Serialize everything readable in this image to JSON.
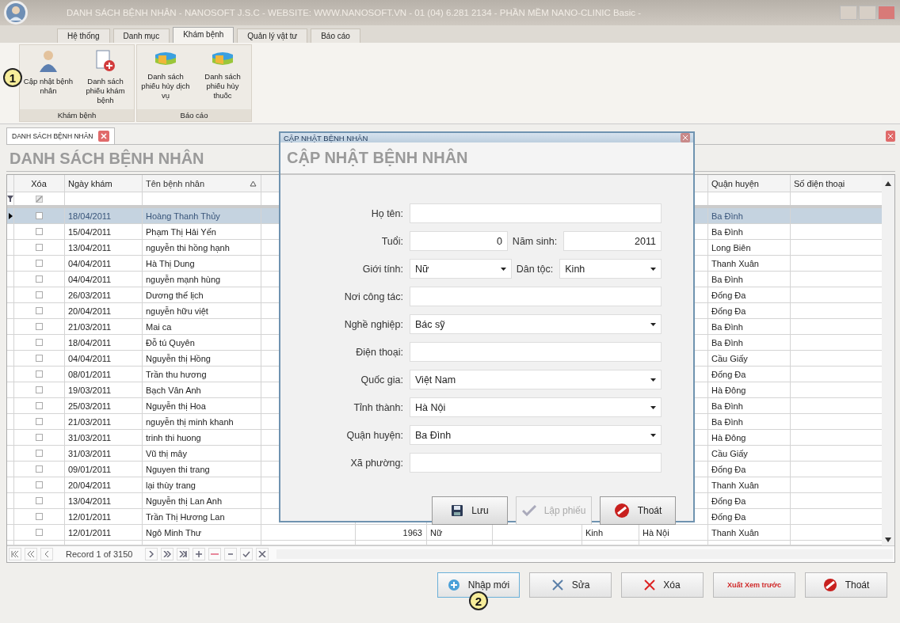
{
  "window": {
    "title": "DANH SÁCH BỆNH NHÂN - NANOSOFT J.S.C - WEBSITE: WWW.NANOSOFT.VN - 01 (04) 6.281 2134 - PHẦN MỀM NANO-CLINIC Basic -"
  },
  "ribbon_tabs": [
    {
      "label": "Hệ thống",
      "selected": false
    },
    {
      "label": "Danh mục",
      "selected": false
    },
    {
      "label": "Khám bệnh",
      "selected": true
    },
    {
      "label": "Quản lý vật tư",
      "selected": false
    },
    {
      "label": "Báo cáo",
      "selected": false
    }
  ],
  "ribbon_groups": [
    {
      "label": "Khám bệnh",
      "buttons": [
        {
          "label": "Cập nhật bệnh nhân",
          "kind": "patient",
          "callout": "1"
        },
        {
          "label": "Danh sách phiếu khám bệnh",
          "kind": "form"
        }
      ]
    },
    {
      "label": "Báo cáo",
      "buttons": [
        {
          "label": "Danh sách phiếu hủy dịch vụ",
          "kind": "pill"
        },
        {
          "label": "Danh sách phiếu hủy thuốc",
          "kind": "pill"
        }
      ]
    }
  ],
  "document_tab": {
    "label": "DANH SÁCH BỆNH NHÂN"
  },
  "list_title": "DANH SÁCH BỆNH NHÂN",
  "table": {
    "headers": {
      "delete": "Xóa",
      "date": "Ngày khám",
      "name": "Tên bệnh nhân",
      "district": "Quận huyện",
      "phone": "Số điện thoại"
    },
    "name_sorted": true,
    "filter_checked": true,
    "rows": [
      {
        "selected": true,
        "checked": false,
        "date": "18/04/2011",
        "name": "Hoàng Thanh Thủy",
        "district": "Ba Đình"
      },
      {
        "selected": false,
        "checked": false,
        "date": "15/04/2011",
        "name": "Phạm Thị Hải Yến",
        "district": "Ba Đình"
      },
      {
        "selected": false,
        "checked": false,
        "date": "13/04/2011",
        "name": "nguyễn thi hồng hạnh",
        "district": "Long Biên"
      },
      {
        "selected": false,
        "checked": false,
        "date": "04/04/2011",
        "name": "Hà Thị Dung",
        "district": "Thanh Xuân"
      },
      {
        "selected": false,
        "checked": false,
        "date": "04/04/2011",
        "name": "nguyễn mạnh hùng",
        "district": "Ba Đình"
      },
      {
        "selected": false,
        "checked": false,
        "date": "26/03/2011",
        "name": "Dương thế lịch",
        "district": "Đống Đa"
      },
      {
        "selected": false,
        "checked": false,
        "date": "20/04/2011",
        "name": "nguyễn hữu việt",
        "district": "Đống Đa"
      },
      {
        "selected": false,
        "checked": false,
        "date": "21/03/2011",
        "name": "Mai ca",
        "district": "Ba Đình"
      },
      {
        "selected": false,
        "checked": false,
        "date": "18/04/2011",
        "name": "Đỗ tú Quyên",
        "district": "Ba Đình"
      },
      {
        "selected": false,
        "checked": false,
        "date": "04/04/2011",
        "name": "Nguyễn thị Hồng",
        "district": "Cầu Giấy"
      },
      {
        "selected": false,
        "checked": false,
        "date": "08/01/2011",
        "name": "Trần thu hương",
        "district": "Đống Đa"
      },
      {
        "selected": false,
        "checked": false,
        "date": "19/03/2011",
        "name": "Bạch Vân Anh",
        "district": "Hà Đông"
      },
      {
        "selected": false,
        "checked": false,
        "date": "25/03/2011",
        "name": "Nguyễn thị Hoa",
        "district": "Ba Đình"
      },
      {
        "selected": false,
        "checked": false,
        "date": "21/03/2011",
        "name": "nguyễn thị minh khanh",
        "district": "Ba Đình"
      },
      {
        "selected": false,
        "checked": false,
        "date": "31/03/2011",
        "name": "trinh thi huong",
        "district": "Hà Đông"
      },
      {
        "selected": false,
        "checked": false,
        "date": "31/03/2011",
        "name": "Vũ thị mây",
        "district": "Cầu Giấy"
      },
      {
        "selected": false,
        "checked": false,
        "date": "09/01/2011",
        "name": "Nguyen thi trang",
        "district": "Đống Đa"
      },
      {
        "selected": false,
        "checked": false,
        "date": "20/04/2011",
        "name": "lại thùy trang",
        "district": "Thanh Xuân"
      },
      {
        "selected": false,
        "checked": false,
        "date": "13/04/2011",
        "name": "Nguyễn thị Lan Anh",
        "district": "Đống Đa"
      },
      {
        "selected": false,
        "checked": false,
        "date": "12/01/2011",
        "name": "Trần Thị Hương Lan",
        "district": "Đống Đa"
      },
      {
        "selected": false,
        "checked": false,
        "date": "12/01/2011",
        "name": "Ngô Minh Thư",
        "birth_year": "1963",
        "gender": "Nữ",
        "ethnicity": "Kinh",
        "province": "Hà Nội",
        "district": "Thanh Xuân"
      }
    ]
  },
  "navigator": {
    "record_text": "Record 1 of 3150"
  },
  "actions": [
    {
      "label": "Nhập mới",
      "kind": "add",
      "callout": "2"
    },
    {
      "label": "Sửa",
      "kind": "edit"
    },
    {
      "label": "Xóa",
      "kind": "delete"
    },
    {
      "label": "Xuất Xem trước",
      "kind": "preview"
    },
    {
      "label": "Thoát",
      "kind": "exit"
    }
  ],
  "dialog": {
    "title": "CẬP NHẬT BỆNH NHÂN",
    "heading": "CẬP NHẬT BỆNH NHÂN",
    "rows": [
      [
        {
          "label": "Họ tên:",
          "kind": "text"
        }
      ],
      [
        {
          "label": "Tuổi:",
          "kind": "number",
          "value": "0"
        },
        {
          "label": "Năm sinh:",
          "kind": "number",
          "value": "2011"
        }
      ],
      [
        {
          "label": "Giới tính:",
          "kind": "select",
          "value": "Nữ"
        },
        {
          "label": "Dân tộc:",
          "kind": "select",
          "value": "Kinh"
        }
      ],
      [
        {
          "label": "Nơi công tác:",
          "kind": "text"
        }
      ],
      [
        {
          "label": "Nghề nghiệp:",
          "kind": "select",
          "value": "Bác sỹ"
        }
      ],
      [
        {
          "label": "Điện thoại:",
          "kind": "text"
        }
      ],
      [
        {
          "label": "Quốc gia:",
          "kind": "select",
          "value": "Việt Nam"
        }
      ],
      [
        {
          "label": "Tỉnh thành:",
          "kind": "select",
          "value": "Hà Nội"
        }
      ],
      [
        {
          "label": "Quận huyện:",
          "kind": "select",
          "value": "Ba Đình"
        }
      ],
      [
        {
          "label": "Xã phường:",
          "kind": "text"
        }
      ]
    ],
    "buttons": [
      {
        "label": "Lưu",
        "kind": "save",
        "disabled": false
      },
      {
        "label": "Lập phiếu",
        "kind": "check",
        "disabled": true
      },
      {
        "label": "Thoát",
        "kind": "exit",
        "disabled": false
      }
    ]
  }
}
